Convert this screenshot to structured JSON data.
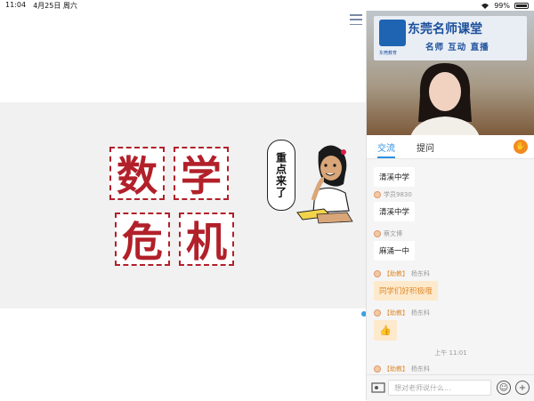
{
  "status_bar": {
    "time": "11:04",
    "date": "4月25日 周六",
    "battery": "99%"
  },
  "slide": {
    "title_chars": [
      "数",
      "学",
      "危",
      "机"
    ],
    "bubble_text": "重点来了"
  },
  "video": {
    "logo_title": "东莞名师课堂",
    "logo_subtitle": "名师 互动 直播",
    "logo_small": "东莞教育"
  },
  "tabs": [
    {
      "label": "交流"
    },
    {
      "label": "提问"
    }
  ],
  "messages": [
    {
      "sender": "",
      "role": "",
      "text": "清溪中学"
    },
    {
      "sender": "学员9830",
      "role": "",
      "text": "清溪中学"
    },
    {
      "sender": "蔡文博",
      "role": "",
      "text": "麻涌一中"
    },
    {
      "sender": "杨东科",
      "role": "【助教】",
      "text": "同学们好积极哦"
    },
    {
      "sender": "杨东科",
      "role": "【助教】",
      "text": "👍"
    },
    {
      "sender": "杨东科",
      "role": "【助教】",
      "text": ""
    }
  ],
  "time_divider": "上午 11:01",
  "input": {
    "placeholder": "想对老师说什么..."
  }
}
